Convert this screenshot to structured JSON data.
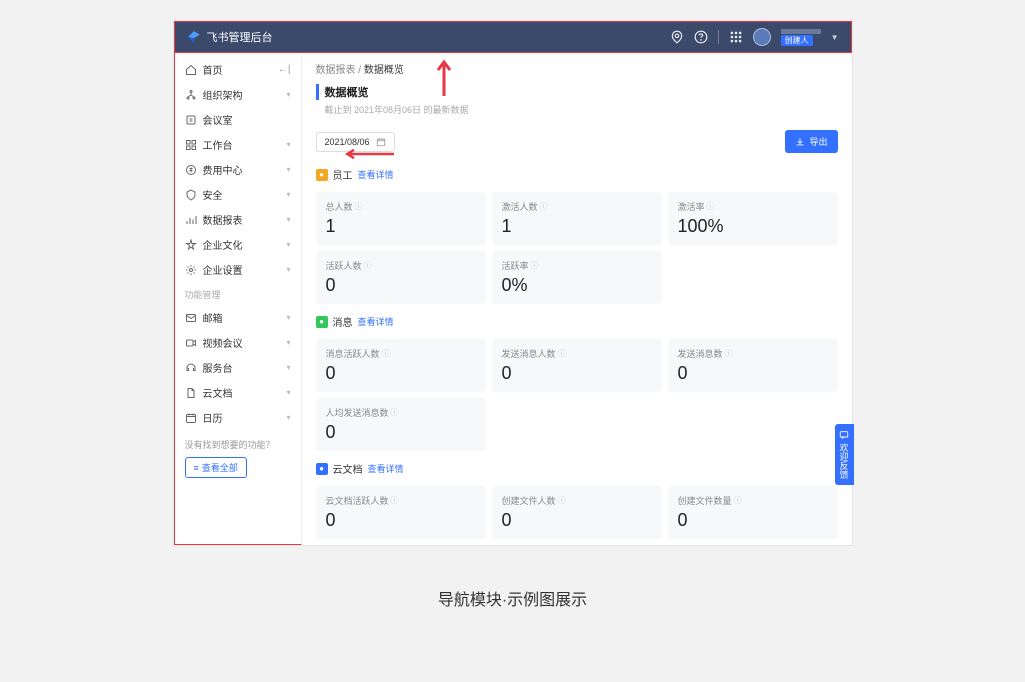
{
  "header": {
    "title": "飞书管理后台",
    "user_tag": "创建人"
  },
  "sidebar": {
    "items": [
      {
        "label": "首页",
        "icon": "home",
        "collapse": true
      },
      {
        "label": "组织架构",
        "icon": "org",
        "expand": true
      },
      {
        "label": "会议室",
        "icon": "meeting"
      },
      {
        "label": "工作台",
        "icon": "workspace",
        "expand": true
      },
      {
        "label": "费用中心",
        "icon": "cost",
        "expand": true
      },
      {
        "label": "安全",
        "icon": "security",
        "expand": true
      },
      {
        "label": "数据报表",
        "icon": "data",
        "expand": true
      },
      {
        "label": "企业文化",
        "icon": "culture",
        "expand": true
      },
      {
        "label": "企业设置",
        "icon": "settings",
        "expand": true
      }
    ],
    "section_label": "功能管理",
    "items2": [
      {
        "label": "邮箱",
        "icon": "mail",
        "expand": true
      },
      {
        "label": "视频会议",
        "icon": "video",
        "expand": true
      },
      {
        "label": "服务台",
        "icon": "service",
        "expand": true
      },
      {
        "label": "云文档",
        "icon": "docs",
        "expand": true
      },
      {
        "label": "日历",
        "icon": "calendar",
        "expand": true
      }
    ],
    "footer_text": "没有找到想要的功能？",
    "view_all": "查看全部"
  },
  "breadcrumb": {
    "parent": "数据报表",
    "current": "数据概览"
  },
  "page": {
    "title": "数据概览",
    "subtitle": "截止到 2021年08月06日 的最新数据",
    "date": "2021/08/06",
    "export": "导出"
  },
  "groups": [
    {
      "name": "员工",
      "icon_color": "#f5a623",
      "link": "查看详情",
      "metrics": [
        {
          "label": "总人数",
          "value": "1"
        },
        {
          "label": "激活人数",
          "value": "1"
        },
        {
          "label": "激活率",
          "value": "100%"
        },
        {
          "label": "活跃人数",
          "value": "0"
        },
        {
          "label": "活跃率",
          "value": "0%"
        }
      ]
    },
    {
      "name": "消息",
      "icon_color": "#34c759",
      "link": "查看详情",
      "metrics": [
        {
          "label": "消息活跃人数",
          "value": "0"
        },
        {
          "label": "发送消息人数",
          "value": "0"
        },
        {
          "label": "发送消息数",
          "value": "0"
        },
        {
          "label": "人均发送消息数",
          "value": "0"
        }
      ]
    },
    {
      "name": "云文档",
      "icon_color": "#3370ff",
      "link": "查看详情",
      "metrics": [
        {
          "label": "云文档活跃人数",
          "value": "0"
        },
        {
          "label": "创建文件人数",
          "value": "0"
        },
        {
          "label": "创建文件数量",
          "value": "0"
        }
      ]
    }
  ],
  "feedback": "欢迎反馈",
  "caption": "导航模块·示例图展示"
}
